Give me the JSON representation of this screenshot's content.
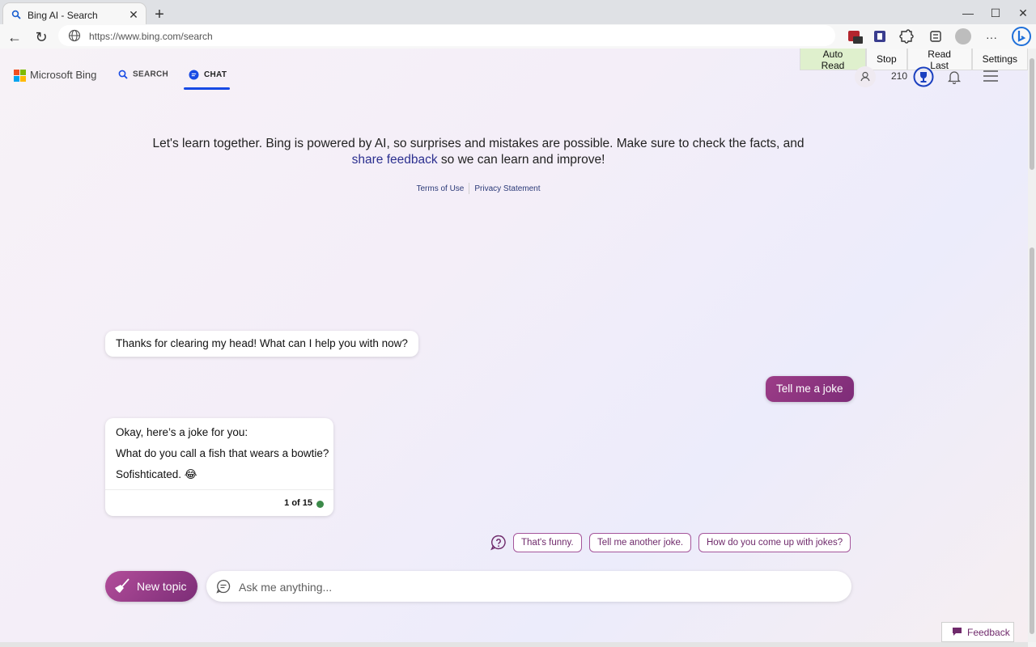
{
  "browser": {
    "tab_title": "Bing AI - Search",
    "url": "https://www.bing.com/search"
  },
  "header": {
    "brand": "Microsoft Bing",
    "nav": {
      "search": "SEARCH",
      "chat": "CHAT"
    },
    "reader_bar": [
      "Auto Read",
      "Stop",
      "Read Last",
      "Settings"
    ],
    "rewards_points": "210"
  },
  "disclaimer": {
    "text": "Let's learn together. Bing is powered by AI, so surprises and mistakes are possible. Make sure to check the facts, and ",
    "link": "share feedback",
    "tail": " so we can learn and improve!",
    "terms": "Terms of Use",
    "privacy": "Privacy Statement"
  },
  "conversation": {
    "bot_message_1": "Thanks for clearing my head! What can I help you with now?",
    "user_message": "Tell me a joke",
    "bot_message_2": {
      "line1": "Okay, here’s a joke for you:",
      "line2": "What do you call a fish that wears a bowtie?",
      "line3": "Sofishticated. 😂",
      "counter": "1 of 15"
    }
  },
  "suggestions": [
    "That's funny.",
    "Tell me another joke.",
    "How do you come up with jokes?"
  ],
  "composer": {
    "new_topic": "New topic",
    "placeholder": "Ask me anything..."
  },
  "feedback": "Feedback",
  "colors": {
    "accent": "#174ae4",
    "chat_purple": "#7d2c78",
    "status_green": "#3c8a4a"
  }
}
